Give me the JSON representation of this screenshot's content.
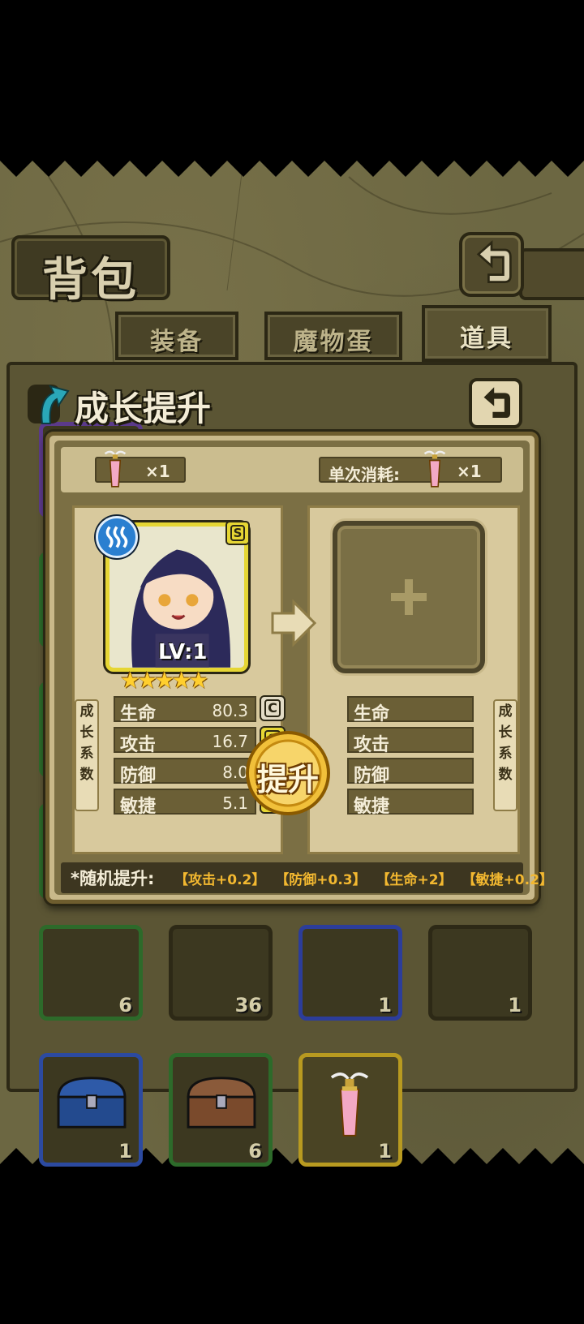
{
  "header": {
    "title": "背包"
  },
  "tabs": [
    {
      "label": "装备",
      "active": false
    },
    {
      "label": "魔物蛋",
      "active": false
    },
    {
      "label": "道具",
      "active": true
    }
  ],
  "dialog": {
    "title": "成长提升",
    "owned_count": "×1",
    "cost_label": "单次消耗:",
    "cost_count": "×1",
    "hero": {
      "level": "LV:1",
      "stars": "★★★★★",
      "element": "water-icon",
      "grade": "S"
    },
    "stats_left": [
      {
        "name": "生命",
        "value": "80.3",
        "grade": "C"
      },
      {
        "name": "攻击",
        "value": "16.7",
        "grade": "S"
      },
      {
        "name": "防御",
        "value": "8.0",
        "grade": "S"
      },
      {
        "name": "敏捷",
        "value": "5.1",
        "grade": "S"
      }
    ],
    "stats_right": [
      {
        "name": "生命"
      },
      {
        "name": "攻击"
      },
      {
        "name": "防御"
      },
      {
        "name": "敏捷"
      }
    ],
    "vertical_label": [
      "成",
      "长",
      "系",
      "数"
    ],
    "upgrade_button": "提升",
    "random_label": "*随机提升:",
    "random_items": [
      "【攻击+0.2】",
      "【防御+0.3】",
      "【生命+2】",
      "【敏捷+0.2】"
    ]
  },
  "inventory": {
    "row1_counts": [
      "6",
      "36",
      "1",
      "1"
    ],
    "row2_counts": [
      "1",
      "6",
      "1"
    ]
  },
  "colors": {
    "gold": "#e6d634",
    "bg": "#6c6742",
    "highlight": "#f3b830"
  }
}
